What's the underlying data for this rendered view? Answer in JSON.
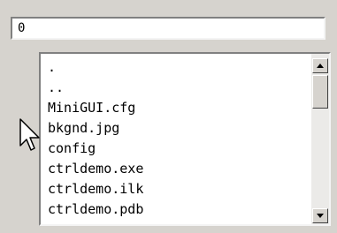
{
  "path_field": {
    "value": "0"
  },
  "file_list": {
    "items": [
      ".",
      "..",
      "MiniGUI.cfg",
      "bkgnd.jpg",
      "config",
      "ctrldemo.exe",
      "ctrldemo.ilk",
      "ctrldemo.pdb"
    ]
  },
  "scrollbar": {
    "up_icon": "triangle-up-icon",
    "down_icon": "triangle-down-icon"
  },
  "cursor": {
    "icon": "arrow-cursor-icon"
  },
  "colors": {
    "background": "#d6d3ce",
    "field": "#ffffff",
    "text": "#000000"
  }
}
